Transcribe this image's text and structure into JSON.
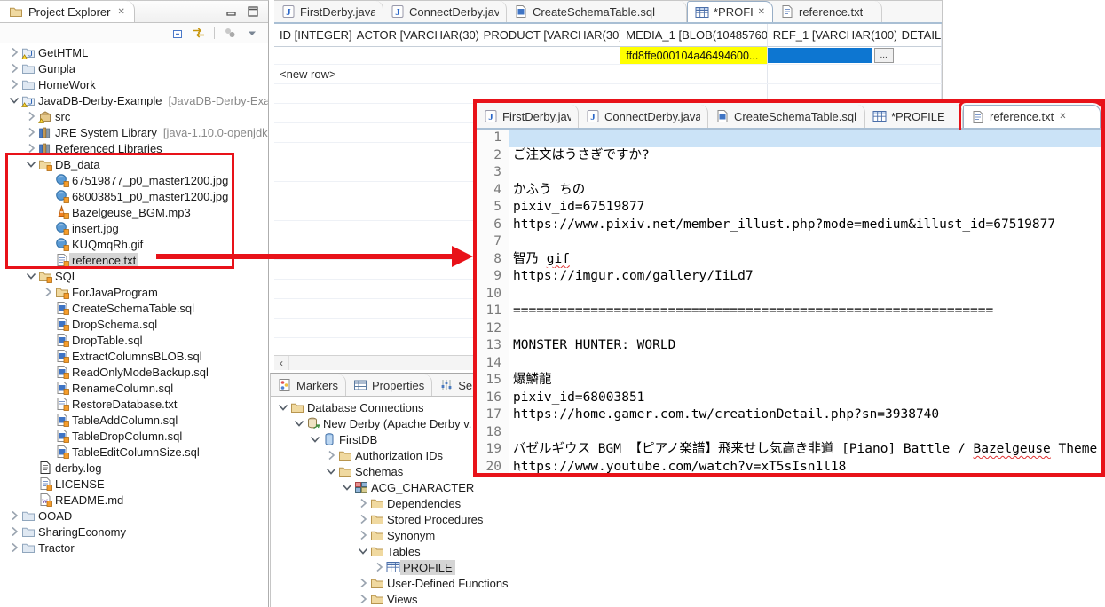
{
  "annotation_color": "#e81219",
  "explorer": {
    "title": "Project Explorer",
    "toolbar_icons": [
      "collapse-all",
      "link-with-editor",
      "sync-disabled",
      "view-menu"
    ],
    "tree": [
      {
        "label": "GetHTML",
        "level": 0,
        "chevron": "collapsed",
        "icon": "java-project"
      },
      {
        "label": "Gunpla",
        "level": 0,
        "chevron": "collapsed",
        "icon": "folder-closed"
      },
      {
        "label": "HomeWork",
        "level": 0,
        "chevron": "collapsed",
        "icon": "folder-closed"
      },
      {
        "label": "JavaDB-Derby-Example",
        "suffix": "[JavaDB-Derby-Exar",
        "level": 0,
        "chevron": "expanded",
        "icon": "java-project"
      },
      {
        "label": "src",
        "level": 1,
        "chevron": "collapsed",
        "icon": "package"
      },
      {
        "label": "JRE System Library",
        "suffix": "[java-1.10.0-openjdk-",
        "level": 1,
        "chevron": "collapsed",
        "icon": "library"
      },
      {
        "label": "Referenced Libraries",
        "level": 1,
        "chevron": "collapsed",
        "icon": "library"
      },
      {
        "label": "DB_data",
        "level": 1,
        "chevron": "expanded",
        "icon": "folder-badge"
      },
      {
        "label": "67519877_p0_master1200.jpg",
        "level": 2,
        "icon": "image-file"
      },
      {
        "label": "68003851_p0_master1200.jpg",
        "level": 2,
        "icon": "image-file"
      },
      {
        "label": "Bazelgeuse_BGM.mp3",
        "level": 2,
        "icon": "audio-file"
      },
      {
        "label": "insert.jpg",
        "level": 2,
        "icon": "image-file"
      },
      {
        "label": "KUQmqRh.gif",
        "level": 2,
        "icon": "image-file"
      },
      {
        "label": "reference.txt",
        "level": 2,
        "icon": "text-file",
        "selected": true
      },
      {
        "label": "SQL",
        "level": 1,
        "chevron": "expanded",
        "icon": "folder-badge"
      },
      {
        "label": "ForJavaProgram",
        "level": 2,
        "chevron": "collapsed",
        "icon": "folder-badge"
      },
      {
        "label": "CreateSchemaTable.sql",
        "level": 2,
        "icon": "sql-file"
      },
      {
        "label": "DropSchema.sql",
        "level": 2,
        "icon": "sql-file"
      },
      {
        "label": "DropTable.sql",
        "level": 2,
        "icon": "sql-file"
      },
      {
        "label": "ExtractColumnsBLOB.sql",
        "level": 2,
        "icon": "sql-file"
      },
      {
        "label": "ReadOnlyModeBackup.sql",
        "level": 2,
        "icon": "sql-file"
      },
      {
        "label": "RenameColumn.sql",
        "level": 2,
        "icon": "sql-file"
      },
      {
        "label": "RestoreDatabase.txt",
        "level": 2,
        "icon": "text-file"
      },
      {
        "label": "TableAddColumn.sql",
        "level": 2,
        "icon": "sql-file"
      },
      {
        "label": "TableDropColumn.sql",
        "level": 2,
        "icon": "sql-file"
      },
      {
        "label": "TableEditColumnSize.sql",
        "level": 2,
        "icon": "sql-file"
      },
      {
        "label": "derby.log",
        "level": 1,
        "icon": "log-file"
      },
      {
        "label": "LICENSE",
        "level": 1,
        "icon": "text-file"
      },
      {
        "label": "README.md",
        "level": 1,
        "icon": "md-file"
      },
      {
        "label": "OOAD",
        "level": 0,
        "chevron": "collapsed",
        "icon": "folder-closed"
      },
      {
        "label": "SharingEconomy",
        "level": 0,
        "chevron": "collapsed",
        "icon": "folder-closed"
      },
      {
        "label": "Tractor",
        "level": 0,
        "chevron": "collapsed",
        "icon": "folder-closed"
      }
    ]
  },
  "editor": {
    "tabs": [
      {
        "label": "FirstDerby.java",
        "icon": "java"
      },
      {
        "label": "ConnectDerby.java",
        "icon": "java"
      },
      {
        "label": "CreateSchemaTable.sql",
        "icon": "sql"
      },
      {
        "label": "*PROFILE",
        "icon": "table",
        "active": true,
        "close": true
      },
      {
        "label": "reference.txt",
        "icon": "txt"
      }
    ],
    "scroll_left": "‹"
  },
  "table": {
    "columns": [
      "ID [INTEGER]",
      "ACTOR [VARCHAR(30)]",
      "PRODUCT [VARCHAR(30)]",
      "MEDIA_1 [BLOB(10485760)]",
      "REF_1 [VARCHAR(100)]",
      "DETAIL"
    ],
    "rows": [
      {
        "cells": [
          {
            "text": ""
          },
          {
            "text": ""
          },
          {
            "text": ""
          },
          {
            "text": "ffd8ffe000104a46494600...",
            "highlight": "yellow"
          },
          {
            "selected_blob": true,
            "button_label": "..."
          },
          {
            "text": ""
          }
        ]
      },
      {
        "cells": [
          {
            "text": "<new row>",
            "newrow": true
          },
          {
            "text": ""
          },
          {
            "text": ""
          },
          {
            "text": ""
          },
          {
            "text": ""
          },
          {
            "text": ""
          }
        ]
      }
    ],
    "empty_row_count": 13
  },
  "bottom": {
    "tabs": [
      {
        "label": "Markers",
        "icon": "markers"
      },
      {
        "label": "Properties",
        "icon": "properties"
      },
      {
        "label": "Servers",
        "icon": "servers"
      }
    ],
    "tree": [
      {
        "label": "Database Connections",
        "level": 0,
        "chevron": "expanded",
        "icon": "folder-plain"
      },
      {
        "label": "New Derby (Apache Derby v.",
        "level": 1,
        "chevron": "expanded",
        "icon": "db-server"
      },
      {
        "label": "FirstDB",
        "level": 2,
        "chevron": "expanded",
        "icon": "database"
      },
      {
        "label": "Authorization IDs",
        "level": 3,
        "chevron": "collapsed",
        "icon": "folder-plain"
      },
      {
        "label": "Schemas",
        "level": 3,
        "chevron": "expanded",
        "icon": "folder-plain"
      },
      {
        "label": "ACG_CHARACTER",
        "level": 4,
        "chevron": "expanded",
        "icon": "schema"
      },
      {
        "label": "Dependencies",
        "level": 5,
        "chevron": "collapsed",
        "icon": "folder-plain"
      },
      {
        "label": "Stored Procedures",
        "level": 5,
        "chevron": "collapsed",
        "icon": "folder-plain"
      },
      {
        "label": "Synonym",
        "level": 5,
        "chevron": "collapsed",
        "icon": "folder-plain"
      },
      {
        "label": "Tables",
        "level": 5,
        "chevron": "expanded",
        "icon": "folder-plain"
      },
      {
        "label": "PROFILE",
        "level": 6,
        "chevron": "collapsed",
        "icon": "table",
        "selected": true
      },
      {
        "label": "User-Defined Functions",
        "level": 5,
        "chevron": "collapsed",
        "icon": "folder-plain"
      },
      {
        "label": "Views",
        "level": 5,
        "chevron": "collapsed",
        "icon": "folder-plain"
      }
    ]
  },
  "inset": {
    "tabs": [
      {
        "label": "FirstDerby.java",
        "icon": "java"
      },
      {
        "label": "ConnectDerby.java",
        "icon": "java"
      },
      {
        "label": "CreateSchemaTable.sql",
        "icon": "sql"
      },
      {
        "label": "*PROFILE",
        "icon": "table"
      },
      {
        "label": "reference.txt",
        "icon": "txt",
        "active": true,
        "close": true,
        "boxed": true
      }
    ],
    "scroll_left": "‹",
    "lines": [
      {
        "num": 1,
        "current": true,
        "segments": []
      },
      {
        "num": 2,
        "segments": [
          {
            "text": "ご注文はうさぎですか?"
          }
        ]
      },
      {
        "num": 3,
        "segments": []
      },
      {
        "num": 4,
        "segments": [
          {
            "text": "かふう ちの"
          }
        ]
      },
      {
        "num": 5,
        "segments": [
          {
            "text": "pixiv_id=67519877"
          }
        ]
      },
      {
        "num": 6,
        "segments": [
          {
            "text": "https://www.pixiv.net/member_illust.php?mode=medium&illust_id=67519877"
          }
        ]
      },
      {
        "num": 7,
        "segments": []
      },
      {
        "num": 8,
        "segments": [
          {
            "text": "智乃 "
          },
          {
            "text": "gif",
            "squiggle": true
          }
        ]
      },
      {
        "num": 9,
        "segments": [
          {
            "text": "https://imgur.com/gallery/IiLd7"
          }
        ]
      },
      {
        "num": 10,
        "segments": []
      },
      {
        "num": 11,
        "segments": [
          {
            "text": "=============================================================="
          }
        ]
      },
      {
        "num": 12,
        "segments": []
      },
      {
        "num": 13,
        "segments": [
          {
            "text": "MONSTER HUNTER: WORLD"
          }
        ]
      },
      {
        "num": 14,
        "segments": []
      },
      {
        "num": 15,
        "segments": [
          {
            "text": "爆鱗龍"
          }
        ]
      },
      {
        "num": 16,
        "segments": [
          {
            "text": "pixiv_id=68003851"
          }
        ]
      },
      {
        "num": 17,
        "segments": [
          {
            "text": "https://home.gamer.com.tw/creationDetail.php?sn=3938740"
          }
        ]
      },
      {
        "num": 18,
        "segments": []
      },
      {
        "num": 19,
        "segments": [
          {
            "text": "バゼルギウス BGM 【ピアノ楽譜】飛来せし気高き非道 [Piano] Battle / "
          },
          {
            "text": "Bazelgeuse",
            "squiggle": true
          },
          {
            "text": " Theme 【MHW】"
          }
        ]
      },
      {
        "num": 20,
        "segments": [
          {
            "text": "https://www.youtube.com/watch?v=xT5sIsn1l18"
          }
        ]
      }
    ]
  }
}
